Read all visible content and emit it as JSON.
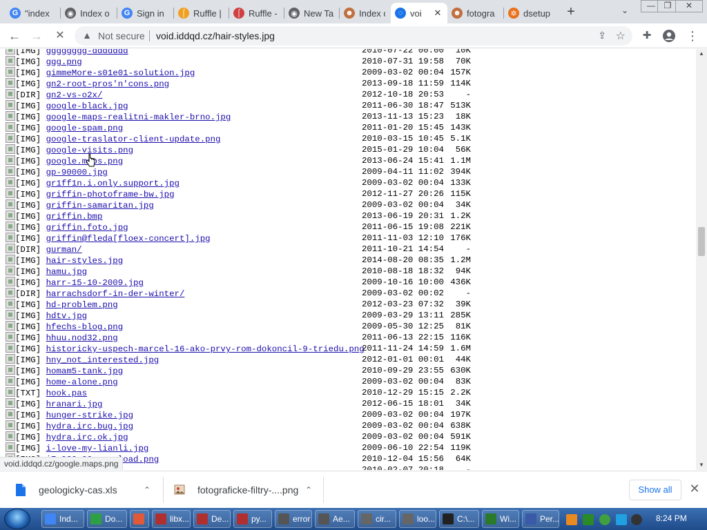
{
  "browser": {
    "tabs": [
      {
        "title": "\"index",
        "icon": "google-icon",
        "color": "#4285f4",
        "glyph": "G"
      },
      {
        "title": "Index o",
        "icon": "chrome-icon",
        "color": "#5f6368",
        "glyph": "◉"
      },
      {
        "title": "Sign in",
        "icon": "google-icon",
        "color": "#4285f4",
        "glyph": "G"
      },
      {
        "title": "Ruffle |",
        "icon": "ruffle-icon",
        "color": "#f0a020",
        "glyph": "⌠"
      },
      {
        "title": "Ruffle -",
        "icon": "ruffle-icon",
        "color": "#d04040",
        "glyph": "⌠"
      },
      {
        "title": "New Ta",
        "icon": "chrome-icon",
        "color": "#5f6368",
        "glyph": "◉"
      },
      {
        "title": "Index o",
        "icon": "avatar-icon",
        "color": "#c07040",
        "glyph": "☻"
      },
      {
        "title": "voi",
        "icon": "loading-icon",
        "color": "#1a73e8",
        "glyph": "◌",
        "active": true
      },
      {
        "title": "fotogra",
        "icon": "avatar-icon",
        "color": "#c07040",
        "glyph": "☻"
      },
      {
        "title": "dsetup",
        "icon": "gear-icon",
        "color": "#e8711c",
        "glyph": "✲"
      }
    ],
    "new_tab": "+",
    "tab_search": "⌄",
    "window_controls": {
      "minimize": "—",
      "restore": "❐",
      "close": "✕"
    },
    "nav": {
      "back": "←",
      "forward": "→",
      "stop": "✕"
    },
    "omnibox": {
      "security_label": "Not secure",
      "url": "void.iddqd.cz/hair-styles.jpg"
    },
    "extensions_icon": "puzzle-icon",
    "profile_icon": "person-icon",
    "menu_icon": "⋮"
  },
  "listing": {
    "rows": [
      {
        "type": "[IMG]",
        "name": "gggggggg-ddddddd",
        "date": "2010-07-22 00:00",
        "size": "10K"
      },
      {
        "type": "[IMG]",
        "name": "ggg.png",
        "date": "2010-07-31 19:58",
        "size": "70K"
      },
      {
        "type": "[IMG]",
        "name": "gimmeMore-s01e01-solution.jpg",
        "date": "2009-03-02 00:04",
        "size": "157K"
      },
      {
        "type": "[IMG]",
        "name": "gn2-root-pros'n'cons.png",
        "date": "2013-09-18 11:59",
        "size": "114K"
      },
      {
        "type": "[DIR]",
        "name": "gn2-vs-o2x/",
        "date": "2012-10-18 20:53",
        "size": "-"
      },
      {
        "type": "[IMG]",
        "name": "google-black.jpg",
        "date": "2011-06-30 18:47",
        "size": "513K"
      },
      {
        "type": "[IMG]",
        "name": "google-maps-realitni-makler-brno.jpg",
        "date": "2013-11-13 15:23",
        "size": "18K"
      },
      {
        "type": "[IMG]",
        "name": "google-spam.png",
        "date": "2011-01-20 15:45",
        "size": "143K"
      },
      {
        "type": "[IMG]",
        "name": "google-traslator-client-update.png",
        "date": "2010-03-15 10:45",
        "size": "5.1K"
      },
      {
        "type": "[IMG]",
        "name": "google-visits.png",
        "date": "2015-01-29 10:04",
        "size": "56K"
      },
      {
        "type": "[IMG]",
        "name": "google.maps.png",
        "date": "2013-06-24 15:41",
        "size": "1.1M"
      },
      {
        "type": "[IMG]",
        "name": "gp-90000.jpg",
        "date": "2009-04-11 11:02",
        "size": "394K"
      },
      {
        "type": "[IMG]",
        "name": "gr1ff1n.i.only.support.jpg",
        "date": "2009-03-02 00:04",
        "size": "133K"
      },
      {
        "type": "[IMG]",
        "name": "griffin-photoframe-bw.jpg",
        "date": "2012-11-27 20:26",
        "size": "115K"
      },
      {
        "type": "[IMG]",
        "name": "griffin-samaritan.jpg",
        "date": "2009-03-02 00:04",
        "size": "34K"
      },
      {
        "type": "[IMG]",
        "name": "griffin.bmp",
        "date": "2013-06-19 20:31",
        "size": "1.2K"
      },
      {
        "type": "[IMG]",
        "name": "griffin.foto.jpg",
        "date": "2011-06-15 19:08",
        "size": "221K"
      },
      {
        "type": "[IMG]",
        "name": "griffin@fleda[floex-concert].jpg",
        "date": "2011-11-03 12:10",
        "size": "176K"
      },
      {
        "type": "[DIR]",
        "name": "gurman/",
        "date": "2011-10-21 14:54",
        "size": "-"
      },
      {
        "type": "[IMG]",
        "name": "hair-styles.jpg",
        "date": "2014-08-20 08:35",
        "size": "1.2M"
      },
      {
        "type": "[IMG]",
        "name": "hamu.jpg",
        "date": "2010-08-18 18:32",
        "size": "94K"
      },
      {
        "type": "[IMG]",
        "name": "harr-15-10-2009.jpg",
        "date": "2009-10-16 10:00",
        "size": "436K"
      },
      {
        "type": "[DIR]",
        "name": "harrachsdorf-in-der-winter/",
        "date": "2009-03-02 00:02",
        "size": "-"
      },
      {
        "type": "[IMG]",
        "name": "hd-problem.png",
        "date": "2012-03-23 07:32",
        "size": "39K"
      },
      {
        "type": "[IMG]",
        "name": "hdtv.jpg",
        "date": "2009-03-29 13:11",
        "size": "285K"
      },
      {
        "type": "[IMG]",
        "name": "hfechs-blog.png",
        "date": "2009-05-30 12:25",
        "size": "81K"
      },
      {
        "type": "[IMG]",
        "name": "hhuu.nod32.png",
        "date": "2011-06-13 22:15",
        "size": "116K"
      },
      {
        "type": "[IMG]",
        "name": "historicky-uspech-marcel-16-ako-prvy-rom-dokoncil-9-triedu.png",
        "date": "2011-11-24 14:59",
        "size": "1.6M"
      },
      {
        "type": "[IMG]",
        "name": "hny_not_interested.jpg",
        "date": "2012-01-01 00:01",
        "size": "44K"
      },
      {
        "type": "[IMG]",
        "name": "homam5-tank.jpg",
        "date": "2010-09-29 23:55",
        "size": "630K"
      },
      {
        "type": "[IMG]",
        "name": "home-alone.png",
        "date": "2009-03-02 00:04",
        "size": "83K"
      },
      {
        "type": "[TXT]",
        "name": "hook.pas",
        "date": "2010-12-29 15:15",
        "size": "2.2K"
      },
      {
        "type": "[IMG]",
        "name": "hranari.jpg",
        "date": "2012-06-15 18:01",
        "size": "34K"
      },
      {
        "type": "[IMG]",
        "name": "hunger-strike.jpg",
        "date": "2009-03-02 00:04",
        "size": "197K"
      },
      {
        "type": "[IMG]",
        "name": "hydra.irc.bug.jpg",
        "date": "2009-03-02 00:04",
        "size": "638K"
      },
      {
        "type": "[IMG]",
        "name": "hydra.irc.ok.jpg",
        "date": "2009-03-02 00:04",
        "size": "591K"
      },
      {
        "type": "[IMG]",
        "name": "i-love-my-lianli.jpg",
        "date": "2009-06-10 22:54",
        "size": "119K"
      },
      {
        "type": "[IMG]",
        "name": "i7-920-00mcrc_load.png",
        "date": "2010-12-04 15:56",
        "size": "64K"
      },
      {
        "type": "[DIR]",
        "name": "i8",
        "date": "2010-02-07 20:18",
        "size": "-"
      }
    ]
  },
  "status_bubble": "void.iddqd.cz/google.maps.png",
  "downloads": {
    "items": [
      {
        "name": "geologicky-cas.xls",
        "icon": "document-icon"
      },
      {
        "name": "fotograficke-filtry-....png",
        "icon": "image-file-icon"
      }
    ],
    "show_all": "Show all",
    "close": "✕"
  },
  "taskbar": {
    "items": [
      {
        "label": "Ind...",
        "color": "#4285f4"
      },
      {
        "label": "Do...",
        "color": "#2ea043"
      },
      {
        "label": "",
        "color": "#e05a3a"
      },
      {
        "label": "libx...",
        "color": "#b03030"
      },
      {
        "label": "De...",
        "color": "#b03030"
      },
      {
        "label": "py...",
        "color": "#b03030"
      },
      {
        "label": "error",
        "color": "#555"
      },
      {
        "label": "Ae...",
        "color": "#555"
      },
      {
        "label": "cir...",
        "color": "#666"
      },
      {
        "label": "loo...",
        "color": "#666"
      },
      {
        "label": "C:\\...",
        "color": "#222"
      },
      {
        "label": "Wi...",
        "color": "#2a7a2a"
      },
      {
        "label": "Per...",
        "color": "#3a5aa8"
      }
    ],
    "clock": "8:24 PM"
  }
}
